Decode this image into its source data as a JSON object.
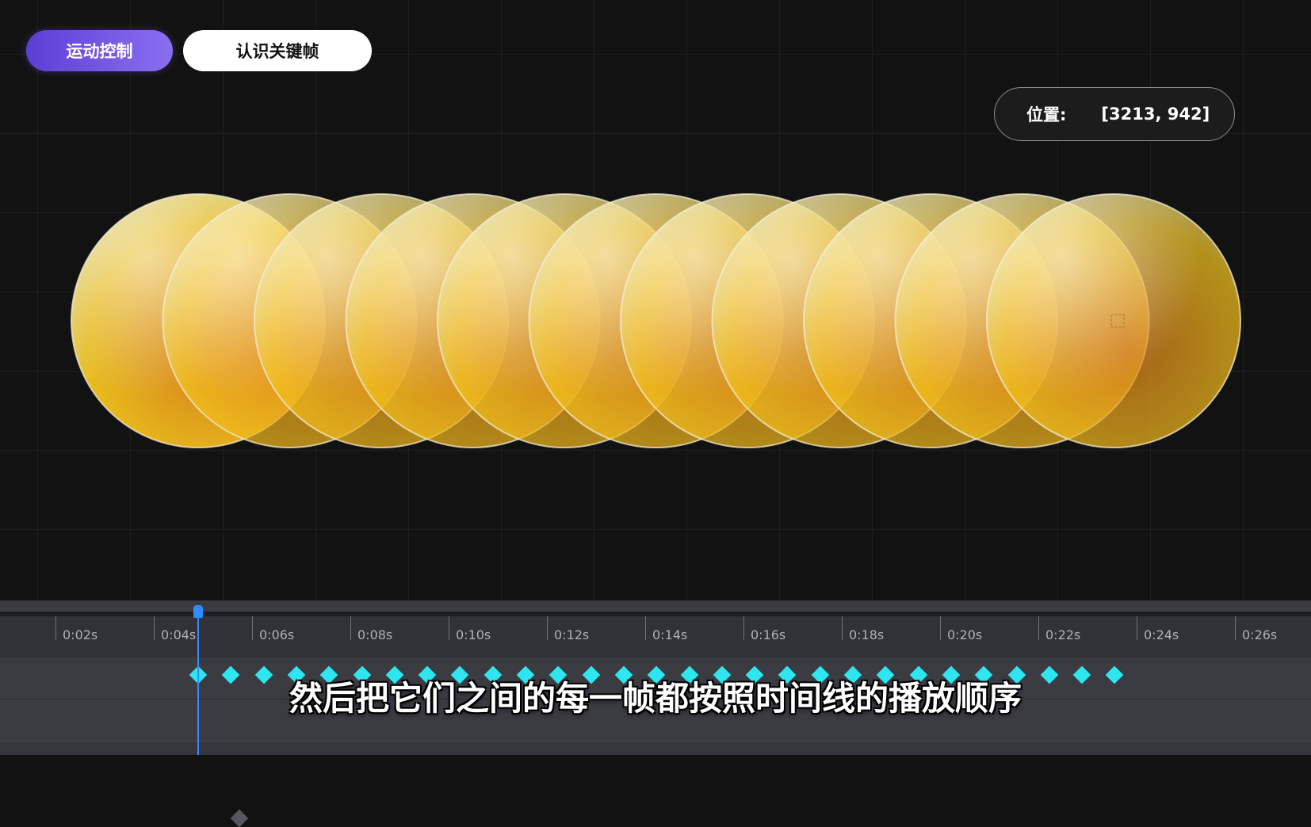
{
  "tabs": {
    "motion_control": "运动控制",
    "keyframe_intro": "认识关键帧"
  },
  "position_readout": {
    "label": "位置:",
    "value": "[3213, 942]"
  },
  "timeline": {
    "tick_labels": [
      "0:02s",
      "0:04s",
      "0:06s",
      "0:08s",
      "0:10s",
      "0:12s",
      "0:14s",
      "0:16s",
      "0:18s",
      "0:20s",
      "0:22s",
      "0:24s",
      "0:26s"
    ],
    "keyframe_count": 29,
    "playhead_time": "0:04.4s"
  },
  "subtitle": "然后把它们之间的每一帧都按照时间线的播放顺序",
  "colors": {
    "accent_purple": "#6a4ee0",
    "keyframe_cyan": "#2ee6f0",
    "playhead_blue": "#2f8cff",
    "ball_yellow": "#f2c21c",
    "ball_orange": "#e07d1a"
  }
}
